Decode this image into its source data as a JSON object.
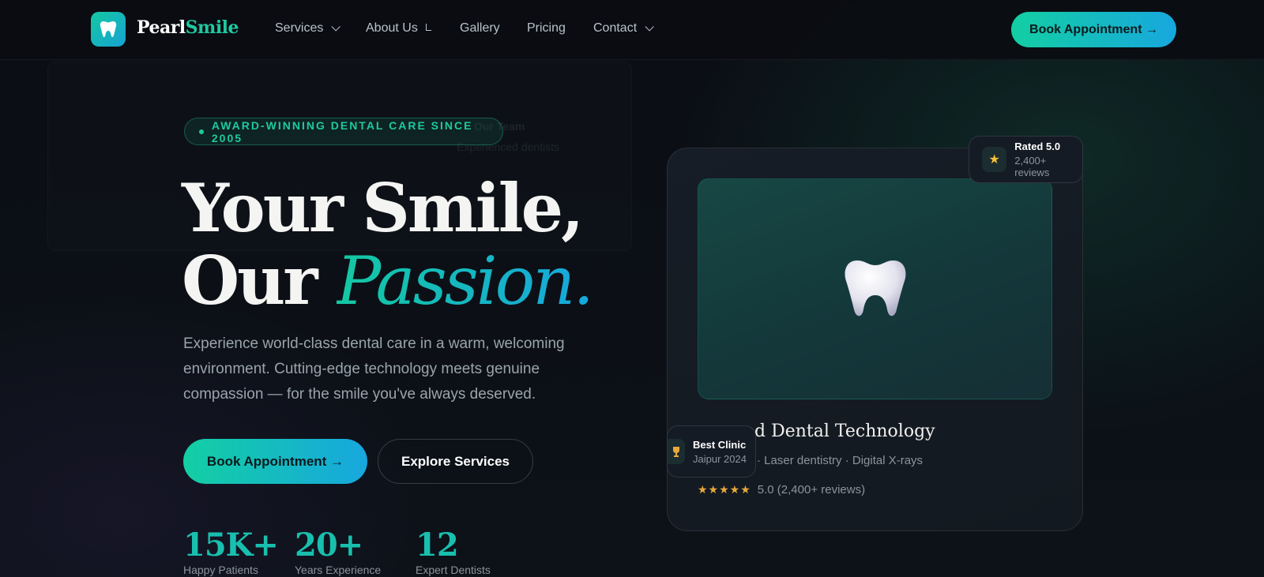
{
  "brand": {
    "name_part1": "Pearl",
    "name_part2": "Smile"
  },
  "nav": {
    "items": [
      {
        "label": "Services",
        "has_dropdown": true
      },
      {
        "label": "About Us",
        "has_dropdown": false
      },
      {
        "label": "Gallery",
        "has_dropdown": false
      },
      {
        "label": "Pricing",
        "has_dropdown": false
      },
      {
        "label": "Contact",
        "has_dropdown": true
      }
    ],
    "cta_label": "Book Appointment →"
  },
  "hero": {
    "badge": "AWARD-WINNING DENTAL CARE SINCE 2005",
    "title_line1": "Your Smile,",
    "title_line2_plain": "Our ",
    "title_line2_accent": "Passion.",
    "lead": "Experience world-class dental care in a warm, welcoming environment. Cutting-edge technology meets genuine compassion — for the smile you've always deserved.",
    "primary_button": "Book Appointment →",
    "secondary_button": "Explore Services",
    "stats": [
      {
        "value": "15K+",
        "label": "Happy Patients"
      },
      {
        "value": "20+",
        "label": "Years Experience"
      },
      {
        "value": "12",
        "label": "Expert Dentists"
      }
    ]
  },
  "card": {
    "title": "ed Dental Technology",
    "subtitle": "· Laser dentistry · Digital X-rays",
    "stars": "★★★★★",
    "rating_text": "5.0 (2,400+ reviews)"
  },
  "badges": {
    "rated": {
      "title": "Rated 5.0",
      "subtitle": "2,400+ reviews"
    },
    "best": {
      "title": "Best Clinic",
      "subtitle": "Jaipur 2024"
    }
  },
  "ghost_menu": {
    "items": [
      {
        "title": "Our Team",
        "subtitle": "Experienced dentists"
      }
    ]
  },
  "colors": {
    "accent_teal": "#1fc9a0",
    "accent_blue": "#17a7de",
    "background": "#0b0e14",
    "star": "#e8a93a"
  },
  "icons": [
    "tooth-icon",
    "chevron-down-icon",
    "star-icon",
    "trophy-icon"
  ]
}
